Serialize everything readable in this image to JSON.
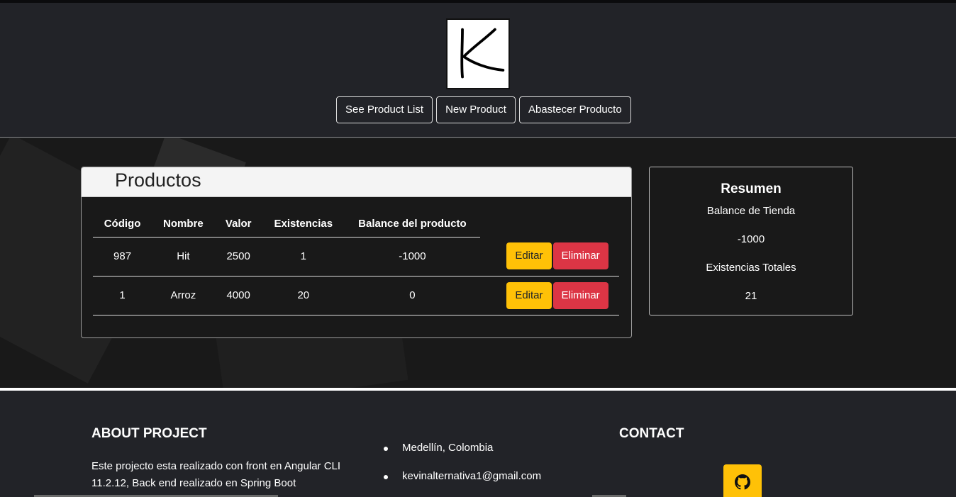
{
  "logo": {
    "letter": "K"
  },
  "nav": {
    "items": [
      {
        "label": "See Product List"
      },
      {
        "label": "New Product"
      },
      {
        "label": "Abastecer Producto"
      }
    ]
  },
  "products": {
    "title": "Productos",
    "columns": [
      "Código",
      "Nombre",
      "Valor",
      "Existencias",
      "Balance del producto"
    ],
    "rows": [
      {
        "codigo": "987",
        "nombre": "Hit",
        "valor": "2500",
        "existencias": "1",
        "balance": "-1000"
      },
      {
        "codigo": "1",
        "nombre": "Arroz",
        "valor": "4000",
        "existencias": "20",
        "balance": "0"
      }
    ],
    "edit_label": "Editar",
    "delete_label": "Eliminar"
  },
  "summary": {
    "title": "Resumen",
    "store_balance_label": "Balance de Tienda",
    "store_balance_value": "-1000",
    "total_stock_label": "Existencias Totales",
    "total_stock_value": "21"
  },
  "footer": {
    "about_title": "ABOUT PROJECT",
    "about_text": "Este projecto esta realizado con front en Angular CLI 11.2.12, Back end realizado en Spring Boot",
    "list": [
      "Medellín, Colombia",
      "kevinalternativa1@gmail.com"
    ],
    "contact_title": "CONTACT",
    "github_icon": "github-icon"
  },
  "colors": {
    "accent_warning": "#ffc107",
    "accent_danger": "#dc3545",
    "background": "#222328"
  }
}
